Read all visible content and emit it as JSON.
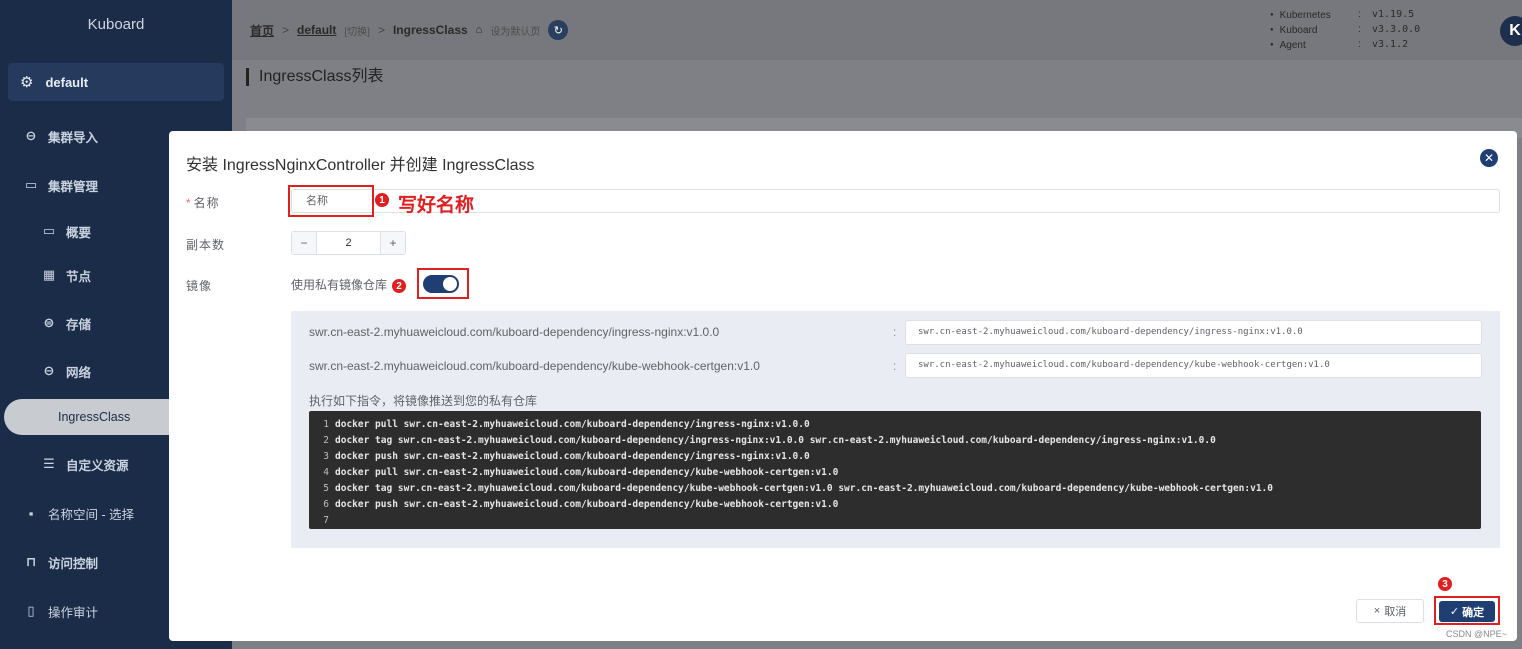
{
  "sidebar": {
    "brand": "Kuboard",
    "cluster": "default",
    "items": [
      {
        "label": "集群导入",
        "icon": "link-icon"
      },
      {
        "label": "集群管理",
        "icon": "folder-icon"
      },
      {
        "label": "概要",
        "icon": "monitor-icon"
      },
      {
        "label": "节点",
        "icon": "grid-icon"
      },
      {
        "label": "存储",
        "icon": "database-icon"
      },
      {
        "label": "网络",
        "icon": "link-icon"
      },
      {
        "label": "IngressClass",
        "icon": ""
      },
      {
        "label": "自定义资源",
        "icon": "sliders-icon"
      },
      {
        "label": "名称空间 - 选择",
        "icon": "apps-icon"
      },
      {
        "label": "访问控制",
        "icon": "lock-icon"
      },
      {
        "label": "操作审计",
        "icon": "doc-icon"
      }
    ]
  },
  "header": {
    "crumb_home": "首页",
    "crumb_cluster": "default",
    "crumb_switch": "[切换]",
    "crumb_page": "IngressClass",
    "set_default": "设为默认页",
    "versions": [
      {
        "name": "Kubernetes",
        "value": "v1.19.5"
      },
      {
        "name": "Kuboard",
        "value": "v3.3.0.0"
      },
      {
        "name": "Agent",
        "value": "v3.1.2"
      }
    ],
    "logo_letter": "K"
  },
  "page": {
    "title": "IngressClass列表"
  },
  "modal": {
    "title": "安装 IngressNginxController 并创建 IngressClass",
    "name_label": "名称",
    "name_value": "名称",
    "replicas_label": "副本数",
    "replicas_value": "2",
    "image_label": "镜像",
    "private_repo_label": "使用私有镜像仓库",
    "private_repo_enabled": true,
    "images": [
      {
        "source": "swr.cn-east-2.myhuaweicloud.com/kuboard-dependency/ingress-nginx:v1.0.0",
        "target": "swr.cn-east-2.myhuaweicloud.com/kuboard-dependency/ingress-nginx:v1.0.0"
      },
      {
        "source": "swr.cn-east-2.myhuaweicloud.com/kuboard-dependency/kube-webhook-certgen:v1.0",
        "target": "swr.cn-east-2.myhuaweicloud.com/kuboard-dependency/kube-webhook-certgen:v1.0"
      }
    ],
    "push_note": "执行如下指令，将镜像推送到您的私有仓库",
    "code_lines": [
      "docker pull swr.cn-east-2.myhuaweicloud.com/kuboard-dependency/ingress-nginx:v1.0.0",
      "docker tag swr.cn-east-2.myhuaweicloud.com/kuboard-dependency/ingress-nginx:v1.0.0 swr.cn-east-2.myhuaweicloud.com/kuboard-dependency/ingress-nginx:v1.0.0",
      "docker push swr.cn-east-2.myhuaweicloud.com/kuboard-dependency/ingress-nginx:v1.0.0",
      "docker pull swr.cn-east-2.myhuaweicloud.com/kuboard-dependency/kube-webhook-certgen:v1.0",
      "docker tag swr.cn-east-2.myhuaweicloud.com/kuboard-dependency/kube-webhook-certgen:v1.0 swr.cn-east-2.myhuaweicloud.com/kuboard-dependency/kube-webhook-certgen:v1.0",
      "docker push swr.cn-east-2.myhuaweicloud.com/kuboard-dependency/kube-webhook-certgen:v1.0",
      ""
    ],
    "cancel_label": "取消",
    "ok_label": "确定"
  },
  "annotations": {
    "step1": "1",
    "step1_text": "写好名称",
    "step2": "2",
    "step3": "3",
    "color": "#e02020"
  },
  "watermark": "CSDN @NPE~"
}
